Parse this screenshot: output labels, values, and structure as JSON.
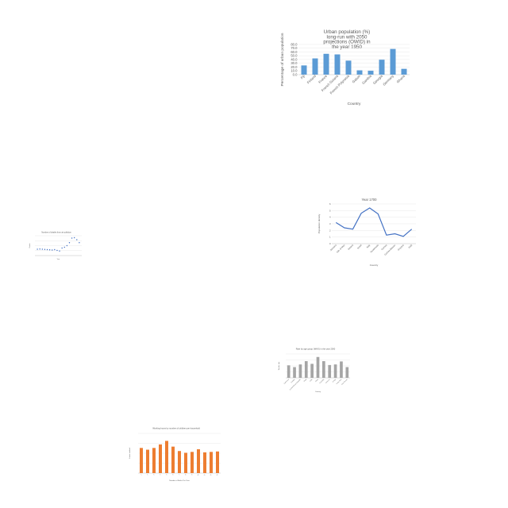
{
  "chart_data": [
    {
      "id": "urban",
      "type": "bar",
      "title": "Urban population (%) long-run with 2050 projections (OWID) in the year 1950",
      "xlabel": "Country",
      "ylabel": "Percentage of urban population",
      "categories": [
        "Fiji",
        "Finland",
        "France",
        "French Guiana",
        "French Polynesia",
        "Gabon",
        "Gambia",
        "Georgia",
        "Germany",
        "Ghana"
      ],
      "values": [
        24.4,
        43,
        55.2,
        53.6,
        37.1,
        11.4,
        10.3,
        39.6,
        68.1,
        15.4
      ],
      "ylim": [
        0,
        80
      ],
      "yticks": [
        "0.0",
        "10.0",
        "20.0",
        "30.0",
        "40.0",
        "50.0",
        "60.0",
        "70.0",
        "80.0"
      ],
      "color": "#5b9bd5",
      "grid": true
    },
    {
      "id": "year1700",
      "type": "line",
      "title": "Year 1700",
      "xlabel": "Country",
      "ylabel": "Population density",
      "categories": [
        "Jamaica",
        "Isle of Man",
        "Ireland",
        "Israel",
        "Italy",
        "Guatemala",
        "Guinea",
        "Guinea-Bissau",
        "Guyana",
        "Haiti"
      ],
      "values": [
        3.2,
        2.4,
        2.2,
        4.6,
        5.4,
        4.5,
        1.3,
        1.5,
        1.1,
        2.2
      ],
      "ylim": [
        0,
        6
      ],
      "yticks": [
        "0",
        "1",
        "2",
        "3",
        "4",
        "5",
        "6"
      ],
      "color": "#4472c4",
      "grid": true
    },
    {
      "id": "scatter",
      "type": "scatter",
      "title": "Number of deaths from air pollution",
      "xlabel": "Year",
      "ylabel": "Deaths",
      "x": [
        1,
        2,
        3,
        4,
        5,
        6,
        7,
        8,
        9,
        10,
        11,
        12,
        13,
        14,
        15,
        16,
        17,
        18
      ],
      "y": [
        3.2,
        3.3,
        3.2,
        3.1,
        3.0,
        2.9,
        2.8,
        3.0,
        2.6,
        2.3,
        3.8,
        4.2,
        5.0,
        6.5,
        8.8,
        9.0,
        8.0,
        6.5
      ],
      "xlim": [
        0,
        19
      ],
      "ylim": [
        0,
        10
      ],
      "color": "#4472c4",
      "grid": true
    },
    {
      "id": "suicide",
      "type": "bar",
      "title": "Rate by age group (WHO) in the year 2000",
      "xlabel": "Country",
      "ylabel": "Suicide rate",
      "categories": [
        "Cameroon",
        "Canada",
        "Central African Republic",
        "Chad",
        "Chile",
        "China",
        "Colombia",
        "Comoros",
        "Congo",
        "Costa Rica",
        "Cote d'Ivoire"
      ],
      "values": [
        4.2,
        3.6,
        4.5,
        5.6,
        4.7,
        7.0,
        5.6,
        4.3,
        4.5,
        5.5,
        3.6
      ],
      "ylim": [
        0,
        8
      ],
      "color": "#a5a5a5",
      "grid": true
    },
    {
      "id": "hours",
      "type": "bar",
      "title": "Working hours by number of children per household",
      "xlabel": "Number of Births Per Year",
      "ylabel": "Hours worked",
      "categories": [
        "1",
        "2",
        "3",
        "4",
        "5",
        "6",
        "7",
        "8",
        "9",
        "10",
        "11",
        "12",
        "13"
      ],
      "values": [
        5.7,
        5.3,
        5.7,
        6.5,
        7.3,
        6.0,
        5.0,
        4.6,
        4.8,
        5.4,
        4.7,
        4.8,
        4.9
      ],
      "ylim": [
        0,
        9
      ],
      "color": "#ed7d31",
      "grid": true
    }
  ]
}
